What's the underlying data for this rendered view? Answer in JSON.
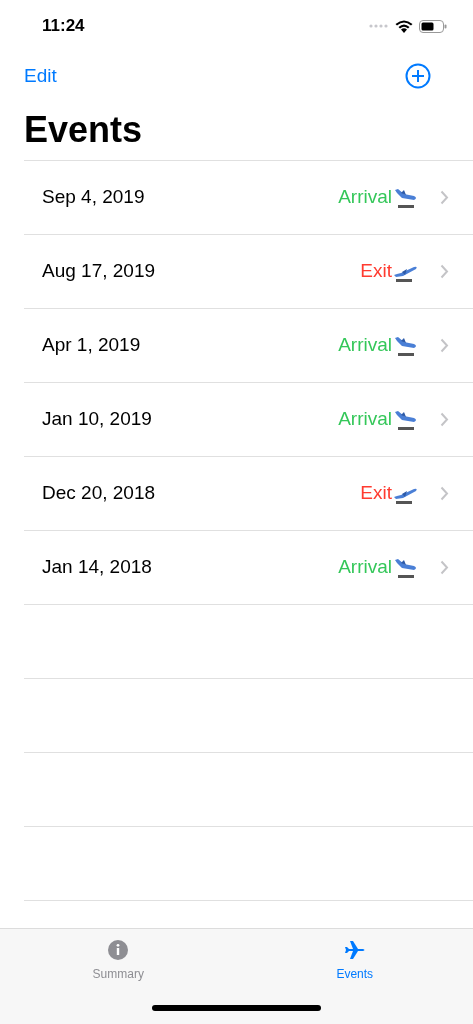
{
  "status_bar": {
    "time": "11:24"
  },
  "nav": {
    "edit": "Edit",
    "title": "Events"
  },
  "events": [
    {
      "date": "Sep 4, 2019",
      "label": "Arrival",
      "kind": "arrival"
    },
    {
      "date": "Aug 17, 2019",
      "label": "Exit",
      "kind": "exit"
    },
    {
      "date": "Apr 1, 2019",
      "label": "Arrival",
      "kind": "arrival"
    },
    {
      "date": "Jan 10, 2019",
      "label": "Arrival",
      "kind": "arrival"
    },
    {
      "date": "Dec 20, 2018",
      "label": "Exit",
      "kind": "exit"
    },
    {
      "date": "Jan 14, 2018",
      "label": "Arrival",
      "kind": "arrival"
    }
  ],
  "tab_bar": [
    {
      "label": "Summary",
      "kind": "info",
      "selected": false
    },
    {
      "label": "Events",
      "kind": "plane",
      "selected": true
    }
  ]
}
